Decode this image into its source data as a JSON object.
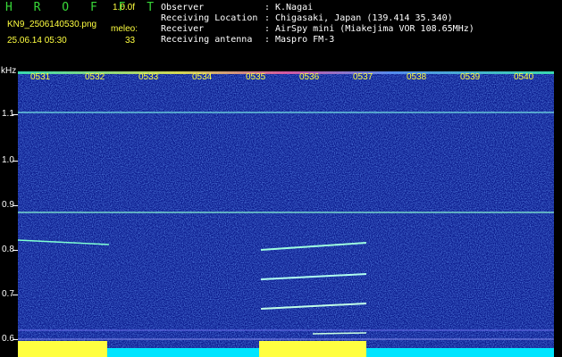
{
  "header": {
    "brand": "H R O F F T",
    "version": "1.0.0f",
    "filename": "KN9_2506140530.png",
    "timestamp": "25.06.14 05:30",
    "meleo_label": "meleo:",
    "meleo_count": "33"
  },
  "info": [
    {
      "key": "Observer",
      "sep": ":",
      "value": "K.Nagai"
    },
    {
      "key": "Receiving Location",
      "sep": ":",
      "value": "Chigasaki, Japan (139.414 35.340)"
    },
    {
      "key": "Receiver",
      "sep": ":",
      "value": "AirSpy mini (Miakejima VOR 108.65MHz)"
    },
    {
      "key": "Receiving antenna",
      "sep": ":",
      "value": "Maspro FM-3"
    }
  ],
  "axis": {
    "unit": "kHz",
    "yticks": [
      "1.1",
      "1.0",
      "0.9",
      "0.8",
      "0.7",
      "0.6"
    ],
    "xticks": [
      "0531",
      "0532",
      "0533",
      "0534",
      "0535",
      "0536",
      "0537",
      "0538",
      "0539",
      "0540"
    ]
  },
  "colors": {
    "background": "#0a1a8c",
    "trace": "#7fffd4",
    "band": "#ffff40",
    "baseline": "#00e5ff"
  }
}
